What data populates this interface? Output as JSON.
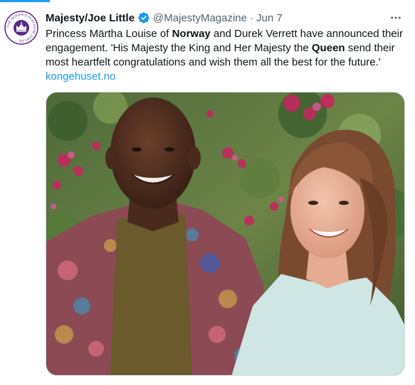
{
  "tweet": {
    "author_name": "Majesty/Joe Little",
    "handle": "@MajestyMagazine",
    "separator": "·",
    "date": "Jun 7",
    "text_parts": [
      "Princess Märtha Louise of ",
      "Norway",
      " and Durek Verrett have announced their engagement. 'His Majesty the King and Her Majesty the ",
      "Queen",
      " send their most heartfelt congratulations and wish them all the best for the future.'"
    ],
    "link": "kongehuset.no",
    "avatar_text": "THE QUEEN'S PLATINUM JUBILEE",
    "icons": {
      "verified": "verified-badge-icon",
      "more": "more-options-icon"
    }
  },
  "colors": {
    "accent": "#1d9bf0",
    "text": "#0f1419",
    "secondary": "#536471",
    "avatar_purple": "#5b2a86"
  }
}
